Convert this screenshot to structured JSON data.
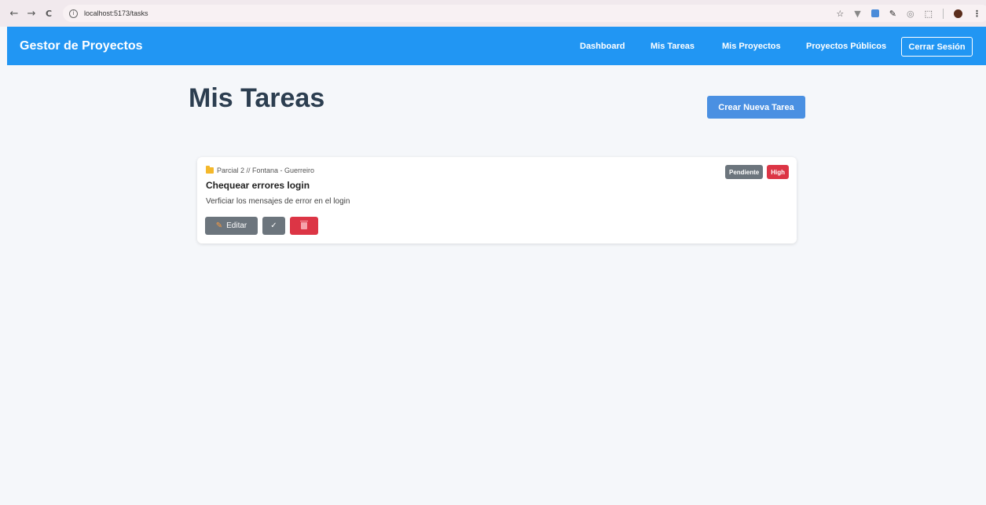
{
  "browser": {
    "url": "localhost:5173/tasks",
    "back_icon": "←",
    "forward_icon": "→",
    "reload_icon": "C",
    "info_icon": "i",
    "star_icon": "☆",
    "menu_icon": "⋮"
  },
  "navbar": {
    "brand": "Gestor de Proyectos",
    "links": {
      "dashboard": "Dashboard",
      "tasks": "Mis Tareas",
      "projects": "Mis Proyectos",
      "public_projects": "Proyectos Públicos"
    },
    "logout": "Cerrar Sesión",
    "color": "#2196f3"
  },
  "main": {
    "title": "Mis Tareas",
    "create_button": "Crear Nueva Tarea"
  },
  "tasks": [
    {
      "project": "Parcial 2 // Fontana - Guerreiro",
      "title": "Chequear errores login",
      "description": "Verficiar los mensajes de error en el login",
      "status": "Pendiente",
      "priority": "High",
      "actions": {
        "edit": "Editar",
        "complete": "✓",
        "edit_icon": "✎"
      }
    }
  ]
}
